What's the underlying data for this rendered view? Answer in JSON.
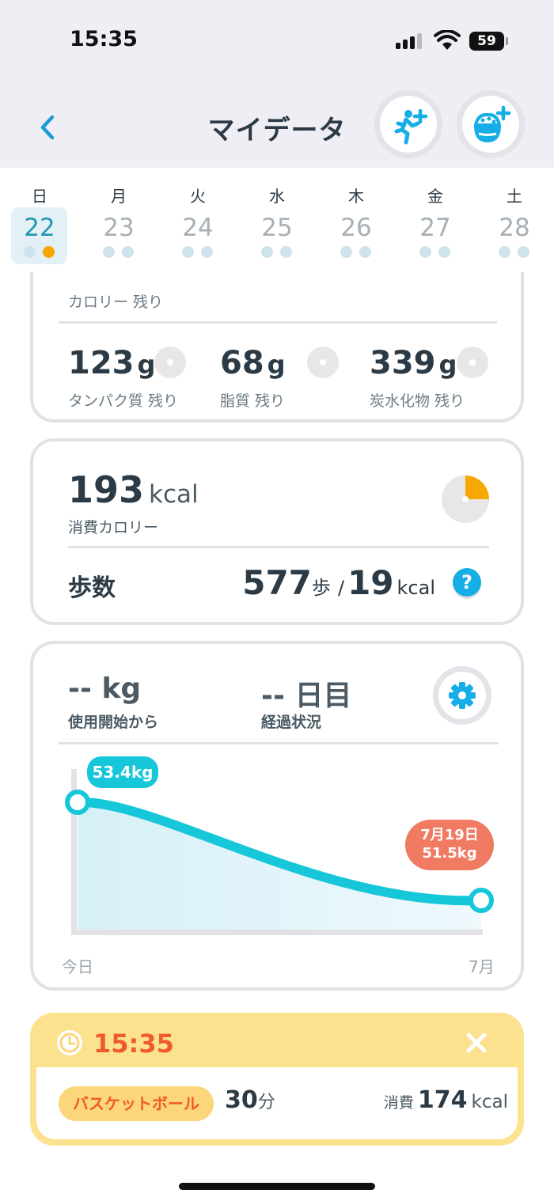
{
  "status_bar": {
    "time": "15:35",
    "battery": "59"
  },
  "header": {
    "title": "マイデータ",
    "back_icon": "chevron-left-icon",
    "actions": [
      "add-exercise-icon",
      "add-meal-icon"
    ]
  },
  "week": {
    "days": [
      {
        "dow": "日",
        "num": "22",
        "selected": true
      },
      {
        "dow": "月",
        "num": "23"
      },
      {
        "dow": "火",
        "num": "24"
      },
      {
        "dow": "水",
        "num": "25"
      },
      {
        "dow": "木",
        "num": "26"
      },
      {
        "dow": "金",
        "num": "27"
      },
      {
        "dow": "土",
        "num": "28"
      }
    ]
  },
  "nutrition": {
    "calorie_label": "カロリー 残り",
    "macros": [
      {
        "value": "123",
        "unit": "g",
        "label": "タンパク質 残り"
      },
      {
        "value": "68",
        "unit": "g",
        "label": "脂質 残り"
      },
      {
        "value": "339",
        "unit": "g",
        "label": "炭水化物 残り"
      }
    ]
  },
  "burn": {
    "value": "193",
    "unit": "kcal",
    "label": "消費カロリー",
    "ring_fraction": 0.25,
    "steps_label": "歩数",
    "steps_value": "577",
    "steps_unit": "歩",
    "sep": "/",
    "steps_kcal": "19",
    "steps_kcal_unit": "kcal",
    "help": "?"
  },
  "weight": {
    "change_value": "--",
    "change_unit": "kg",
    "change_label": "使用開始から",
    "days_value": "--",
    "days_unit": "日目",
    "days_label": "経過状況",
    "start_tag": "53.4kg",
    "end_tag_date": "7月19日",
    "end_tag_weight": "51.5kg",
    "x_start": "今日",
    "x_end": "7月"
  },
  "chart_data": {
    "type": "area",
    "x": [
      "今日",
      "7月19日"
    ],
    "y": [
      53.4,
      51.5
    ],
    "xlabel": "",
    "ylabel": "",
    "colors": {
      "line": "#16c6d9",
      "fill": "#dff4fa"
    }
  },
  "activity_log": {
    "time": "15:35",
    "activity": "バスケットボール",
    "duration_value": "30",
    "duration_unit": "分",
    "burn_label": "消費",
    "burn_value": "174",
    "burn_unit": "kcal"
  },
  "colors": {
    "accent": "#16aee6",
    "teal": "#16c6d9",
    "orange": "#f6a800",
    "coral": "#f07a62",
    "log_bg": "#fce18e"
  }
}
